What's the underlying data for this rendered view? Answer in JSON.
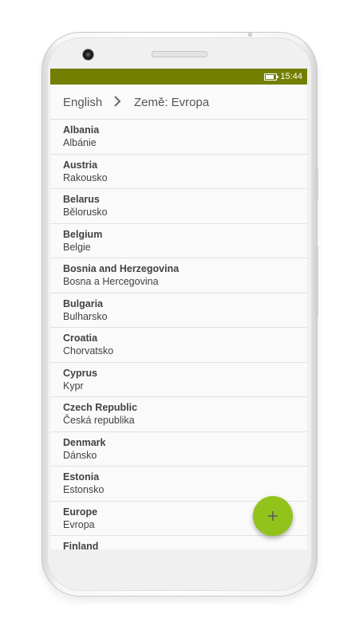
{
  "status_bar": {
    "time": "15:44",
    "battery_level": 0.8,
    "color": "#737f00"
  },
  "breadcrumb": {
    "root": "English",
    "separator_icon": "chevron-right-icon",
    "current": "Země: Evropa"
  },
  "countries": [
    {
      "name": "Albania",
      "translation": "Albánie"
    },
    {
      "name": "Austria",
      "translation": "Rakousko"
    },
    {
      "name": "Belarus",
      "translation": "Bělorusko"
    },
    {
      "name": "Belgium",
      "translation": "Belgie"
    },
    {
      "name": "Bosnia and Herzegovina",
      "translation": "Bosna a Hercegovina"
    },
    {
      "name": "Bulgaria",
      "translation": "Bulharsko"
    },
    {
      "name": "Croatia",
      "translation": "Chorvatsko"
    },
    {
      "name": "Cyprus",
      "translation": "Kypr"
    },
    {
      "name": "Czech Republic",
      "translation": "Česká republika"
    },
    {
      "name": "Denmark",
      "translation": "Dánsko"
    },
    {
      "name": "Estonia",
      "translation": "Estonsko"
    },
    {
      "name": "Europe",
      "translation": "Evropa"
    },
    {
      "name": "Finland",
      "translation": ""
    }
  ],
  "fab": {
    "icon": "plus-icon",
    "color": "#92c31b"
  }
}
